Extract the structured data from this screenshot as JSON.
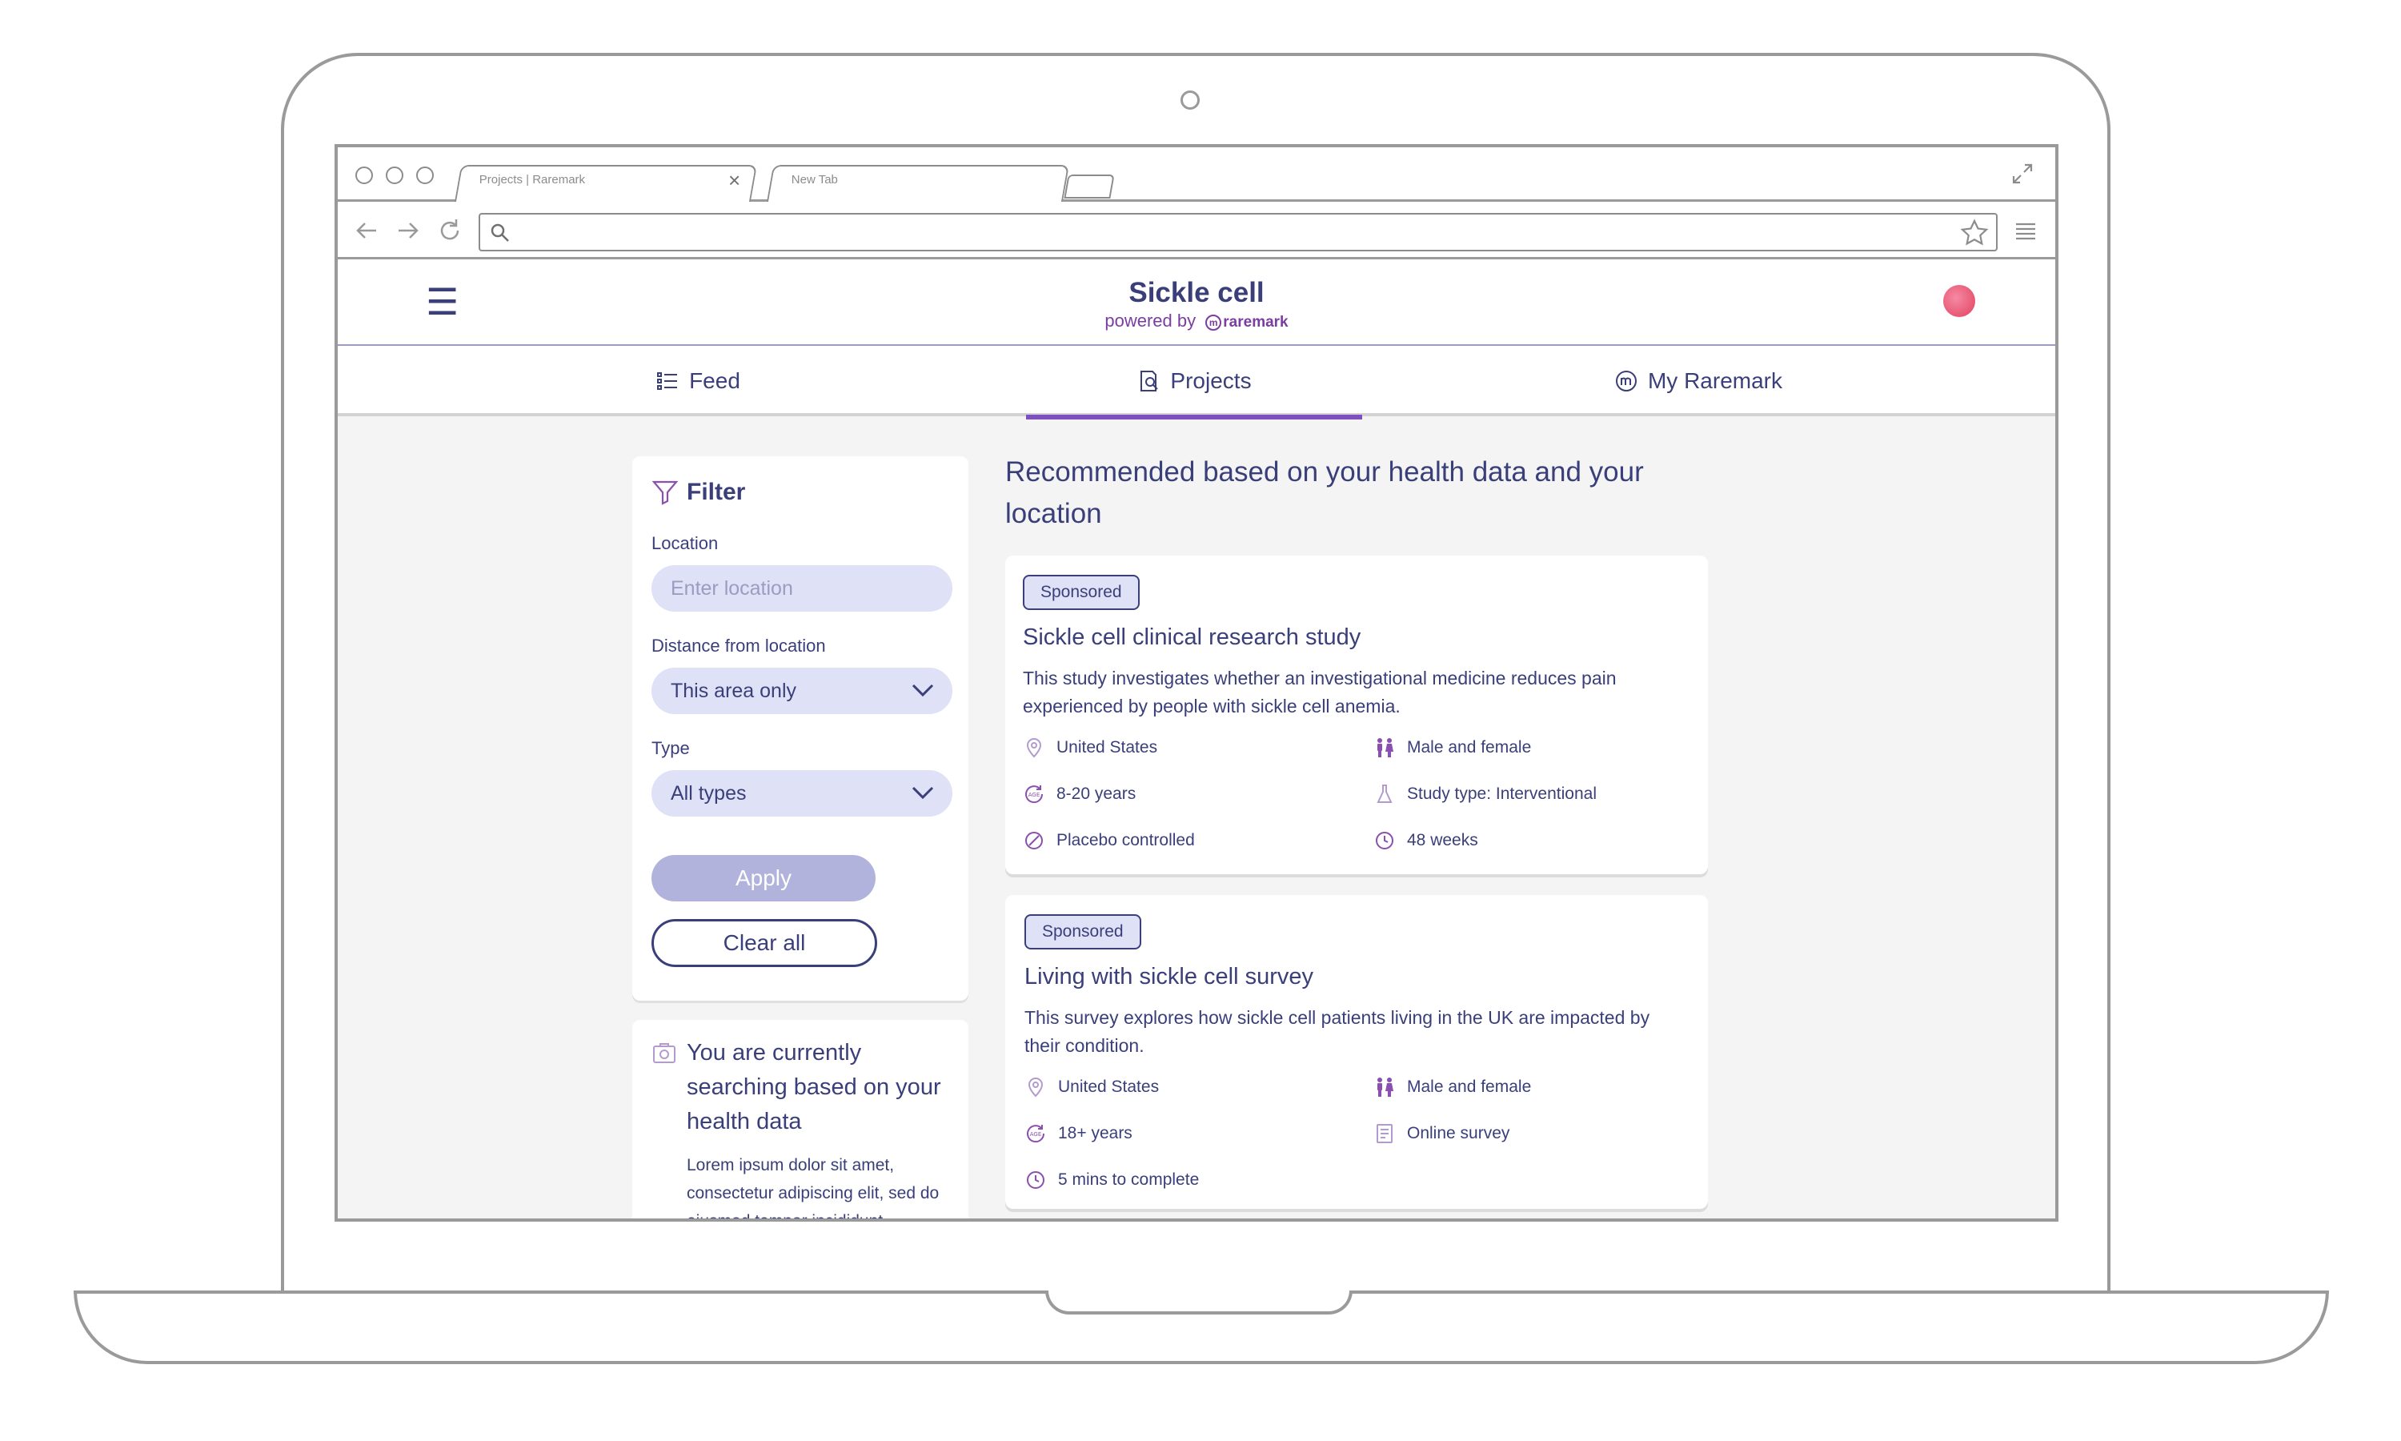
{
  "browser": {
    "tabs": [
      {
        "label": "Projects | Raremark"
      },
      {
        "label": "New Tab"
      }
    ],
    "close_glyph": "×",
    "url_value": "",
    "icons": [
      "back-arrow-icon",
      "forward-arrow-icon",
      "refresh-icon",
      "search-icon",
      "star-icon",
      "menu-lines-icon",
      "expand-icon"
    ]
  },
  "header": {
    "menu_glyph": "☰",
    "title": "Sickle cell",
    "powered_by": "powered by",
    "brand_mark": "m",
    "brand": "raremark",
    "avatar_color": "#e2405f"
  },
  "main_tabs": [
    {
      "label": "Feed",
      "icon": "feed-list-icon",
      "active": false
    },
    {
      "label": "Projects",
      "icon": "projects-icon",
      "active": true
    },
    {
      "label": "My Raremark",
      "icon": "raremark-logo-icon",
      "active": false
    }
  ],
  "filter": {
    "title": "Filter",
    "location_label": "Location",
    "location_placeholder": "Enter location",
    "distance_label": "Distance from location",
    "distance_value": "This area only",
    "type_label": "Type",
    "type_value": "All types",
    "apply_label": "Apply",
    "clear_label": "Clear all"
  },
  "info": {
    "heading": "You are currently searching based on your health data",
    "body": "Lorem ipsum dolor sit amet, consectetur adipiscing elit, sed do eiusmod tempor incididunt"
  },
  "recommendations": {
    "heading": "Recommended based on your health data and your location",
    "cards": [
      {
        "badge": "Sponsored",
        "title": "Sickle cell clinical research study",
        "description": "This study investigates whether an investigational medicine reduces pain experienced by people with sickle cell anemia.",
        "meta": [
          {
            "icon": "location-pin-icon",
            "text": "United States"
          },
          {
            "icon": "gender-icon",
            "text": "Male and female"
          },
          {
            "icon": "age-icon",
            "text": "8-20 years"
          },
          {
            "icon": "flask-icon",
            "text": "Study type: Interventional"
          },
          {
            "icon": "placebo-icon",
            "text": "Placebo controlled"
          },
          {
            "icon": "clock-icon",
            "text": "48 weeks"
          }
        ]
      },
      {
        "badge": "Sponsored",
        "title": "Living with sickle cell survey",
        "description": "This survey explores how sickle cell patients living in the UK are impacted by their condition.",
        "meta": [
          {
            "icon": "location-pin-icon",
            "text": "United States"
          },
          {
            "icon": "gender-icon",
            "text": "Male and female"
          },
          {
            "icon": "age-icon",
            "text": "18+ years"
          },
          {
            "icon": "survey-icon",
            "text": "Online survey"
          },
          {
            "icon": "clock-icon",
            "text": "5 mins to complete"
          }
        ]
      }
    ]
  },
  "colors": {
    "brand_navy": "#3a3f7a",
    "accent_purple": "#7d4fbf",
    "icon_purple": "#8a4fb0",
    "pill_bg": "#dfe1f6",
    "apply_disabled": "#b1b3dc",
    "page_bg": "#f4f4f5"
  }
}
